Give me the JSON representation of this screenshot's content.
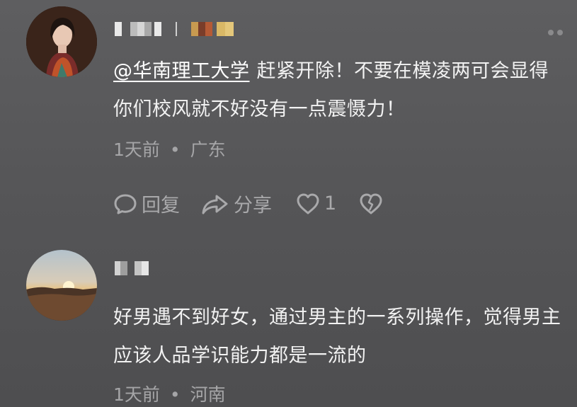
{
  "comments": [
    {
      "mention": "@华南理工大学",
      "text": "赶紧开除！不要在模凌两可会显得你们校风就不好没有一点震慑力！",
      "time": "1天前",
      "separator": "•",
      "location": "广东",
      "actions": {
        "reply_label": "回复",
        "share_label": "分享",
        "like_count": "1"
      }
    },
    {
      "text": "好男遇不到好女，通过男主的一系列操作，觉得男主应该人品学识能力都是一流的",
      "time": "1天前",
      "separator": "•",
      "location": "河南"
    }
  ],
  "icons": [
    "more-icon",
    "reply-icon",
    "share-icon",
    "like-icon",
    "dislike-icon"
  ]
}
